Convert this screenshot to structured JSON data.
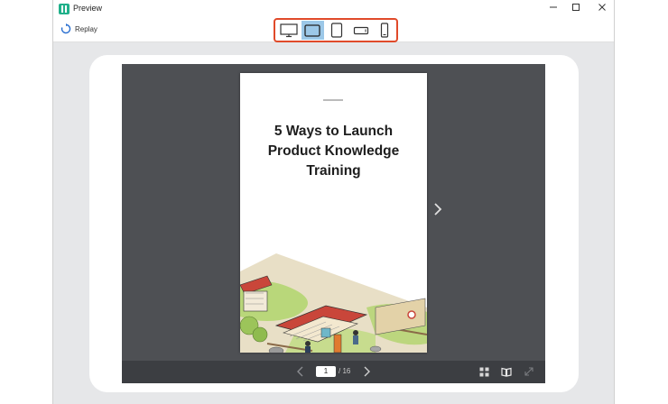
{
  "window": {
    "title": "Preview",
    "controls": [
      "minimize",
      "maximize",
      "close"
    ]
  },
  "toolbar": {
    "replay_label": "Replay",
    "devices": [
      {
        "name": "desktop",
        "icon": "monitor-icon",
        "active": false
      },
      {
        "name": "tablet-landscape",
        "icon": "tablet-landscape-icon",
        "active": true
      },
      {
        "name": "tablet-portrait",
        "icon": "tablet-portrait-icon",
        "active": false
      },
      {
        "name": "phone-landscape",
        "icon": "phone-landscape-icon",
        "active": false
      },
      {
        "name": "phone-portrait",
        "icon": "phone-portrait-icon",
        "active": false
      }
    ],
    "highlight_color": "#e04a2a"
  },
  "page": {
    "title": "5 Ways to Launch\nProduct Knowledge\nTraining",
    "illustration": "japanese-village-archery-illustration"
  },
  "viewer": {
    "current_page": "1",
    "page_total": "/ 16"
  },
  "colors": {
    "viewer_bg": "#4e5054",
    "viewer_bar": "#3c3e42",
    "active_device": "#9cc8e8"
  }
}
